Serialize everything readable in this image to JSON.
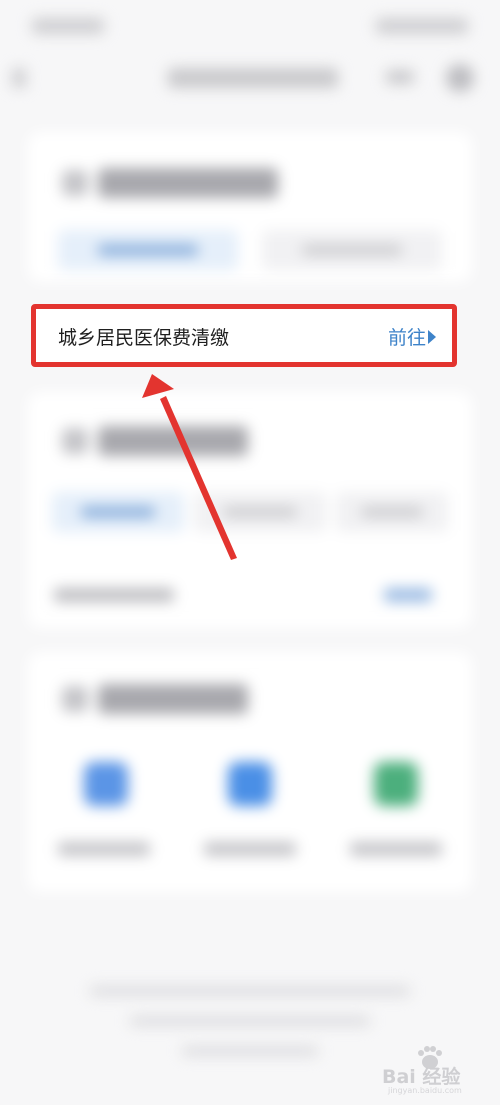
{
  "highlighted_item": {
    "label": "城乡居民医保费清缴",
    "action_label": "前往",
    "icon": "chevron-right-icon"
  },
  "watermark": {
    "logo_text": "Bai 经验",
    "sub_text": "jingyan.baidu.com"
  },
  "colors": {
    "highlight_border": "#e3342f",
    "arrow": "#e3342f",
    "link": "#3e83c9",
    "page_background": "#f7f7f8"
  }
}
